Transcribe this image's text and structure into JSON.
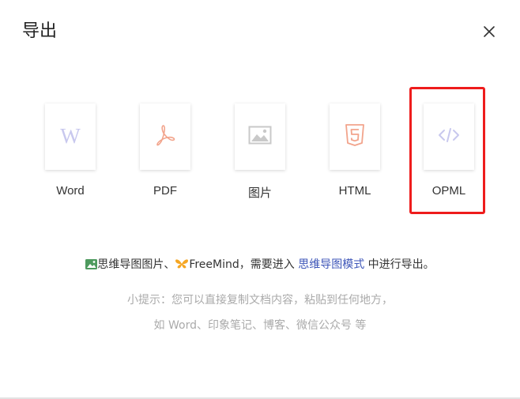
{
  "dialog": {
    "title": "导出",
    "close_icon": "close-icon"
  },
  "formats": [
    {
      "label": "Word",
      "icon": "word-icon"
    },
    {
      "label": "PDF",
      "icon": "pdf-icon"
    },
    {
      "label": "图片",
      "icon": "image-icon"
    },
    {
      "label": "HTML",
      "icon": "html5-icon"
    },
    {
      "label": "OPML",
      "icon": "code-icon"
    }
  ],
  "notice": {
    "image_text": "思维导图图片、",
    "freemind_text": "FreeMind，需要进入 ",
    "link_text": "思维导图模式",
    "suffix_text": " 中进行导出。"
  },
  "tip": {
    "line1": "小提示：您可以直接复制文档内容，粘贴到任何地方，",
    "line2": "如 Word、印象笔记、博客、微信公众号 等"
  },
  "colors": {
    "highlight_border": "#ee1c1c",
    "link": "#3d55b8",
    "word_icon": "#c8c8ee",
    "pdf_icon": "#f2a48c",
    "html_icon": "#f2a48c",
    "code_icon": "#c8c8ee"
  }
}
